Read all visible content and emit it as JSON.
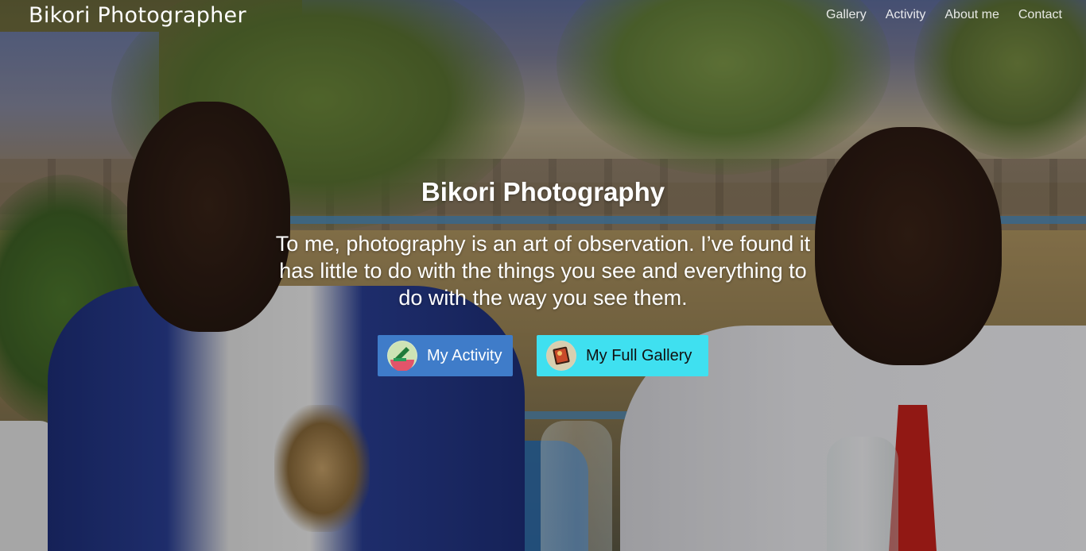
{
  "navbar": {
    "brand": "Bikori Photographer",
    "links": [
      "Gallery",
      "Activity",
      "About me",
      "Contact"
    ]
  },
  "hero": {
    "title": "Bikori Photography",
    "quote": "To me, photography is an art of observation. I’ve found it has little to do with the things you see and everything to do with the way you see them.",
    "buttons": {
      "activity": {
        "label": "My Activity",
        "icon": "activity-icon",
        "color": "#3f7cc9"
      },
      "gallery": {
        "label": "My Full Gallery",
        "icon": "gallery-icon",
        "color": "#3fe0f0"
      }
    }
  }
}
